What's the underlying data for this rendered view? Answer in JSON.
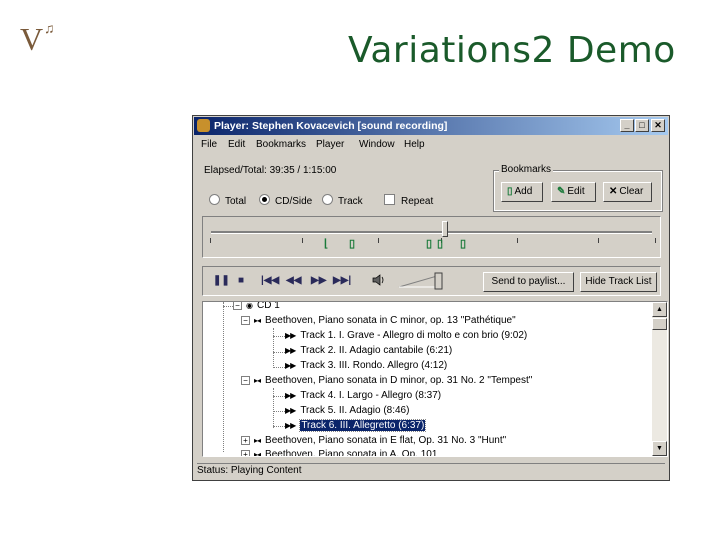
{
  "slide": {
    "title": "Variations2 Demo",
    "logo_letter": "V",
    "logo_note": "♫"
  },
  "window": {
    "title": "Player: Stephen Kovacevich [sound recording]",
    "minimize": "_",
    "maximize": "□",
    "close": "✕"
  },
  "menu": [
    "File",
    "Edit",
    "Bookmarks",
    "Player",
    "Window",
    "Help"
  ],
  "elapsed": {
    "label": "Elapsed/Total:",
    "value": "39:35 / 1:15:00"
  },
  "mode": {
    "total": "Total",
    "cd_side": "CD/Side",
    "track": "Track",
    "selected": "CD/Side"
  },
  "repeat_label": "Repeat",
  "bookmarks": {
    "legend": "Bookmarks",
    "add": "Add",
    "edit": "Edit",
    "clear": "Clear"
  },
  "transport": {
    "pause_icon": "pause-icon",
    "stop_icon": "stop-icon"
  },
  "buttons": {
    "send_to_playlist": "Send to paylist...",
    "hide_track_list": "Hide Track List"
  },
  "tree": {
    "root": "CD 1",
    "works": [
      {
        "title": "Beethoven, Piano sonata in C minor, op. 13 \"Pathétique\"",
        "expanded": true,
        "tracks": [
          "Track 1. I. Grave - Allegro di molto e con brio (9:02)",
          "Track 2. II. Adagio cantabile (6:21)",
          "Track 3. III. Rondo. Allegro (4:12)"
        ]
      },
      {
        "title": "Beethoven, Piano sonata in D minor, op. 31 No. 2 \"Tempest\"",
        "expanded": true,
        "tracks": [
          "Track 4. I. Largo - Allegro (8:37)",
          "Track 5. II. Adagio (8:46)",
          "Track 6. III. Allegretto (6:37)"
        ]
      },
      {
        "title": "Beethoven, Piano sonata in E flat, Op. 31 No. 3 \"Hunt\"",
        "expanded": false,
        "tracks": []
      },
      {
        "title": "Beethoven, Piano sonata in A, Op. 101",
        "expanded": false,
        "tracks": []
      }
    ],
    "selected_track": "Track 6. III. Allegretto (6:37)"
  },
  "status": "Status: Playing Content",
  "timeline": {
    "playhead_fraction": 0.53
  },
  "colors": {
    "title_green": "#1a5a2a",
    "bookmark_green": "#1a7a3a",
    "titlebar_blue": "#0a246a"
  }
}
